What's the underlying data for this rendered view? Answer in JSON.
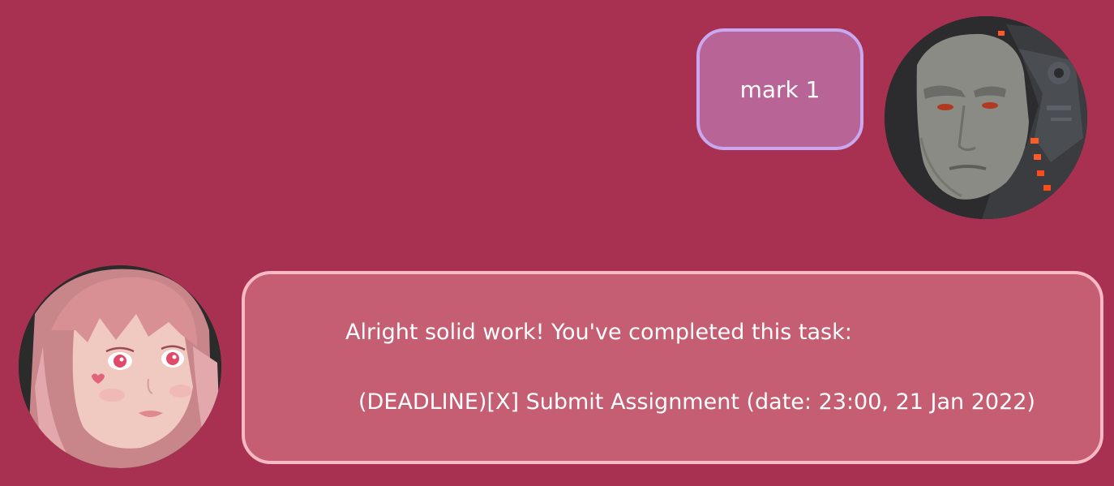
{
  "messages": {
    "user": {
      "text": "mark 1",
      "avatar_icon": "cyborg-man-avatar-icon",
      "bubble_color": "#b86496",
      "bubble_border": "#c8a8f0"
    },
    "bot": {
      "line1": "Alright solid work! You've completed this task:",
      "line2": "(DEADLINE)[X] Submit Assignment (date: 23:00, 21 Jan 2022)",
      "avatar_icon": "anime-girl-avatar-icon",
      "bubble_color": "#c55e72",
      "bubble_border": "#f8b8c4"
    }
  },
  "colors": {
    "background": "#a83050"
  }
}
